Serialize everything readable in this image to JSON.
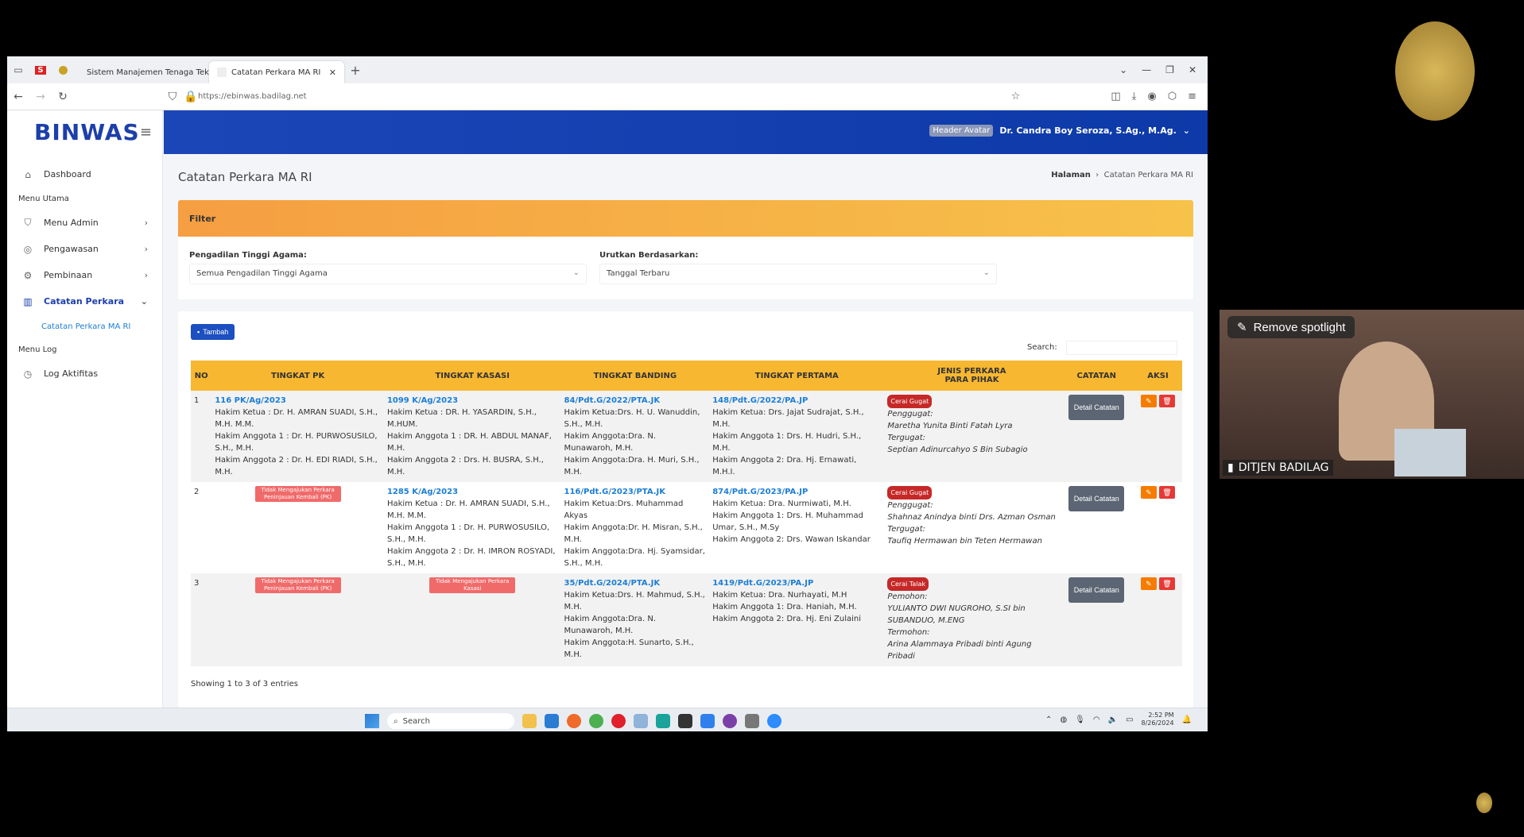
{
  "browser": {
    "tabs": [
      {
        "label": "Sistem Manajemen Tenaga Tek"
      },
      {
        "label": "Catatan Perkara MA RI"
      }
    ],
    "url": "https://ebinwas.badilag.net"
  },
  "app": {
    "logo": "BINWAS",
    "user": {
      "avatar_label": "Header Avatar",
      "name": "Dr. Candra Boy Seroza, S.Ag., M.Ag."
    }
  },
  "sidebar": {
    "dashboard": "Dashboard",
    "section_main": "Menu Utama",
    "menu_admin": "Menu Admin",
    "pengawasan": "Pengawasan",
    "pembinaan": "Pembinaan",
    "catatan_perkara": "Catatan Perkara",
    "sub_catatan": "Catatan Perkara MA RI",
    "section_log": "Menu Log",
    "log_aktifitas": "Log Aktifitas"
  },
  "page": {
    "title": "Catatan Perkara MA RI",
    "breadcrumb_home": "Halaman",
    "breadcrumb_current": "Catatan Perkara MA RI"
  },
  "filter": {
    "heading": "Filter",
    "pta_label": "Pengadilan Tinggi Agama:",
    "pta_value": "Semua Pengadilan Tinggi Agama",
    "sort_label": "Urutkan Berdasarkan:",
    "sort_value": "Tanggal Terbaru"
  },
  "table": {
    "add_label": "Tambah",
    "search_label": "Search:",
    "headers": {
      "no": "NO",
      "pk": "TINGKAT PK",
      "kasasi": "TINGKAT KASASI",
      "banding": "TINGKAT BANDING",
      "pertama": "TINGKAT PERTAMA",
      "jenis1": "JENIS PERKARA",
      "jenis2": "PARA PIHAK",
      "catatan": "CATATAN",
      "aksi": "AKSI"
    },
    "detail_label": "Detail Catatan",
    "rows": [
      {
        "no": "1",
        "pk_case": "116 PK/Ag/2023",
        "pk_l1": "Hakim Ketua : Dr. H. AMRAN SUADI, S.H., M.H. M.M.",
        "pk_l2": "Hakim Anggota 1 : Dr. H. PURWOSUSILO, S.H., M.H.",
        "pk_l3": "Hakim Anggota 2 : Dr. H. EDI RIADI, S.H., M.H.",
        "kas_case": "1099 K/Ag/2023",
        "kas_l1": "Hakim Ketua : DR. H. YASARDIN, S.H., M.HUM.",
        "kas_l2": "Hakim Anggota 1 : DR. H. ABDUL MANAF, M.H.",
        "kas_l3": "Hakim Anggota 2 : Drs. H. BUSRA, S.H., M.H.",
        "ban_case": "84/Pdt.G/2022/PTA.JK",
        "ban_l1": "Hakim Ketua:Drs. H. U. Wanuddin, S.H., M.H.",
        "ban_l2": "Hakim Anggota:Dra. N. Munawaroh, M.H.",
        "ban_l3": "Hakim Anggota:Dra. H. Muri, S.H., M.H.",
        "per_case": "148/Pdt.G/2022/PA.JP",
        "per_l1": "Hakim Ketua: Drs. Jajat Sudrajat, S.H., M.H.",
        "per_l2": "Hakim Anggota 1: Drs. H. Hudri, S.H., M.H.",
        "per_l3": "Hakim Anggota 2: Dra. Hj. Ernawati, M.H.I.",
        "jenis": "Cerai Gugat",
        "p1_role": "Penggugat:",
        "p1_name": "Maretha Yunita Binti Fatah Lyra",
        "p2_role": "Tergugat:",
        "p2_name": "Septian Adinurcahyo S Bin Subagio"
      },
      {
        "no": "2",
        "pk_badge": "Tidak Mengajukan Perkara Peninjauan Kembali (PK)",
        "kas_case": "1285 K/Ag/2023",
        "kas_l1": "Hakim Ketua : Dr. H. AMRAN SUADI, S.H., M.H. M.M.",
        "kas_l2": "Hakim Anggota 1 : Dr. H. PURWOSUSILO, S.H., M.H.",
        "kas_l3": "Hakim Anggota 2 : Dr. H. IMRON ROSYADI, S.H., M.H.",
        "ban_case": "116/Pdt.G/2023/PTA.JK",
        "ban_l1": "Hakim Ketua:Drs. Muhammad Akyas",
        "ban_l2": "Hakim Anggota:Dr. H. Misran, S.H., M.H.",
        "ban_l3": "Hakim Anggota:Dra. Hj. Syamsidar, S.H., M.H.",
        "per_case": "874/Pdt.G/2023/PA.JP",
        "per_l1": "Hakim Ketua: Dra. Nurmiwati, M.H.",
        "per_l2": "Hakim Anggota 1: Drs. H. Muhammad Umar, S.H., M.Sy",
        "per_l3": "Hakim Anggota 2: Drs. Wawan Iskandar",
        "jenis": "Cerai Gugat",
        "p1_role": "Penggugat:",
        "p1_name": "Shahnaz Anindya binti Drs. Azman Osman",
        "p2_role": "Tergugat:",
        "p2_name": "Taufiq Hermawan bin Teten Hermawan"
      },
      {
        "no": "3",
        "pk_badge": "Tidak Mengajukan Perkara Peninjauan Kembali (PK)",
        "kas_badge": "Tidak Mengajukan Perkara Kasasi",
        "ban_case": "35/Pdt.G/2024/PTA.JK",
        "ban_l1": "Hakim Ketua:Drs. H. Mahmud, S.H., M.H.",
        "ban_l2": "Hakim Anggota:Dra. N. Munawaroh, M.H.",
        "ban_l3": "Hakim Anggota:H. Sunarto, S.H., M.H.",
        "per_case": "1419/Pdt.G/2023/PA.JP",
        "per_l1": "Hakim Ketua: Dra. Nurhayati, M.H",
        "per_l2": "Hakim Anggota 1: Dra. Haniah, M.H.",
        "per_l3": "Hakim Anggota 2: Dra. Hj. Eni Zulaini",
        "jenis": "Cerai Talak",
        "p1_role": "Pemohon:",
        "p1_name": "YULIANTO DWI NUGROHO, S.SI bin SUBANDUO, M.ENG",
        "p2_role": "Termohon:",
        "p2_name": "Arina Alammaya Pribadi binti Agung Pribadi"
      }
    ],
    "entries": "Showing 1 to 3 of 3 entries"
  },
  "taskbar": {
    "search": "Search",
    "time": "2:52 PM",
    "date": "8/26/2024"
  },
  "video": {
    "spotlight": "Remove spotlight",
    "name": "DITJEN BADILAG"
  }
}
